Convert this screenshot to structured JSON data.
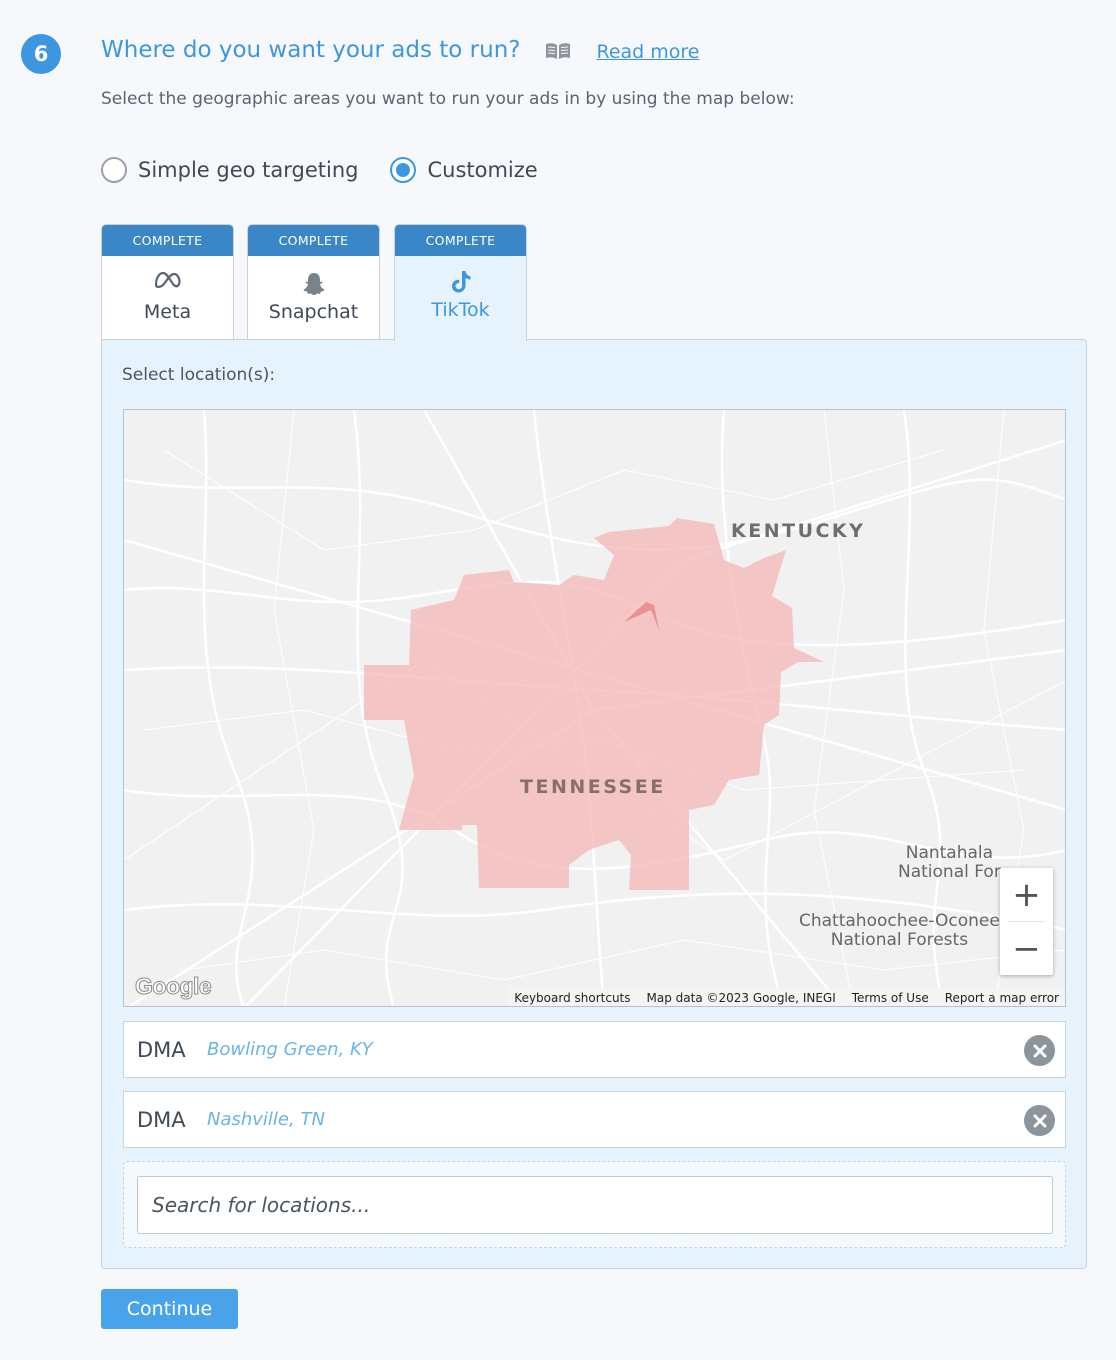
{
  "step": {
    "number": "6",
    "title": "Where do you want your ads to run?",
    "read_more": "Read more",
    "subtitle": "Select the geographic areas you want to run your ads in by using the map below:"
  },
  "targeting": {
    "options": [
      {
        "label": "Simple geo targeting",
        "selected": false
      },
      {
        "label": "Customize",
        "selected": true
      }
    ]
  },
  "tabs": [
    {
      "status": "COMPLETE",
      "label": "Meta",
      "icon": "meta-icon",
      "active": false
    },
    {
      "status": "COMPLETE",
      "label": "Snapchat",
      "icon": "snapchat-icon",
      "active": false
    },
    {
      "status": "COMPLETE",
      "label": "TikTok",
      "icon": "tiktok-icon",
      "active": true
    }
  ],
  "panel": {
    "label": "Select location(s):"
  },
  "map": {
    "labels": {
      "kentucky": "KENTUCKY",
      "tennessee": "TENNESSEE",
      "nantahala": "Nantahala\nNational For",
      "chattahoochee": "Chattahoochee-Oconee\nNational Forests"
    },
    "zoom_in": "+",
    "zoom_out": "−",
    "logo": "Google",
    "footer": {
      "shortcuts": "Keyboard shortcuts",
      "data": "Map data ©2023 Google, INEGI",
      "terms": "Terms of Use",
      "report": "Report a map error"
    },
    "highlight_color": "#f3b6b6"
  },
  "locations": [
    {
      "type": "DMA",
      "name": "Bowling Green, KY"
    },
    {
      "type": "DMA",
      "name": "Nashville, TN"
    }
  ],
  "search": {
    "placeholder": "Search for locations..."
  },
  "continue_label": "Continue",
  "colors": {
    "accent": "#3d97e0",
    "tab_header": "#3b86c6",
    "panel_bg": "#e6f3fc"
  }
}
